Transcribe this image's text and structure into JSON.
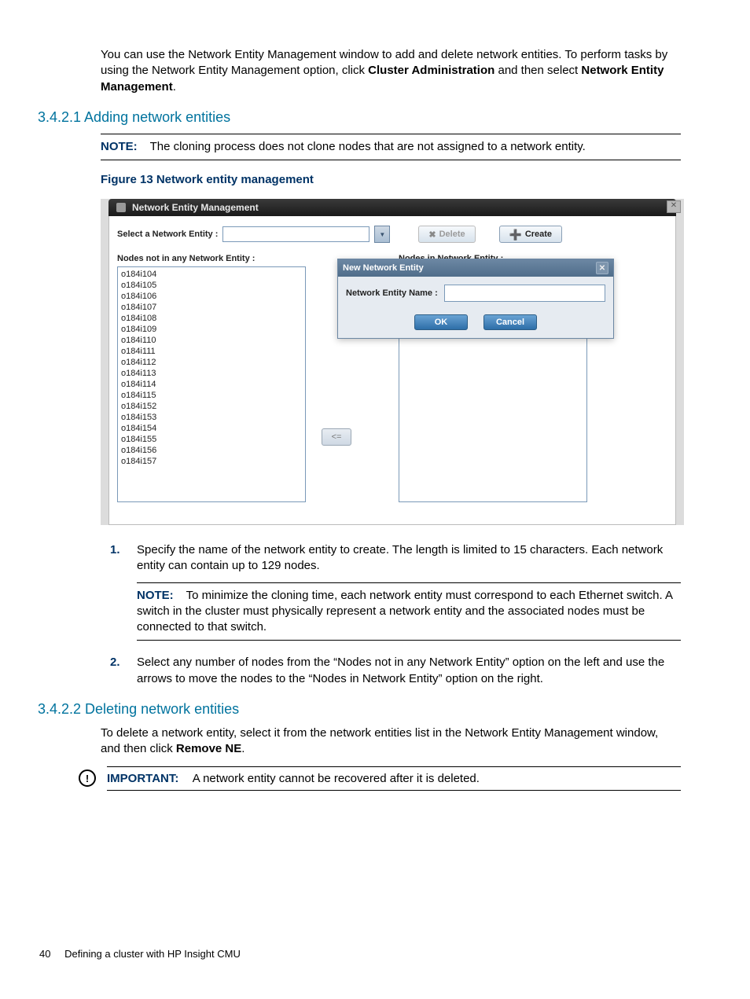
{
  "intro": {
    "p1a": "You can use the Network Entity Management window to add and delete network entities. To perform tasks by using the Network Entity Management option, click ",
    "p1b": "Cluster Administration",
    "p1c": " and then select ",
    "p1d": "Network Entity Management",
    "p1e": "."
  },
  "section1": {
    "heading": "3.4.2.1 Adding network entities",
    "note_label": "NOTE:",
    "note_text": "The cloning process does not clone nodes that are not assigned to a network entity."
  },
  "figure": {
    "caption": "Figure 13 Network entity management"
  },
  "window": {
    "title": "Network Entity Management",
    "select_label": "Select a Network Entity :",
    "delete_btn": "Delete",
    "create_btn": "Create",
    "left_list_label": "Nodes not in any Network Entity :",
    "right_list_label": "Nodes in Network Entity :",
    "arrow_left": "<=",
    "nodes": [
      "o184i104",
      "o184i105",
      "o184i106",
      "o184i107",
      "o184i108",
      "o184i109",
      "o184i110",
      "o184i111",
      "o184i112",
      "o184i113",
      "o184i114",
      "o184i115",
      "o184i152",
      "o184i153",
      "o184i154",
      "o184i155",
      "o184i156",
      "o184i157"
    ],
    "popup": {
      "title": "New Network Entity",
      "field_label": "Network Entity Name :",
      "ok": "OK",
      "cancel": "Cancel"
    }
  },
  "steps": {
    "s1": "Specify the name of the network entity to create. The length is limited to 15 characters. Each network entity can contain up to 129 nodes.",
    "s1_note_label": "NOTE:",
    "s1_note": "To minimize the cloning time, each network entity must correspond to each Ethernet switch. A switch in the cluster must physically represent a network entity and the associated nodes must be connected to that switch.",
    "s2": "Select any number of nodes from the “Nodes not in any Network Entity” option on the left and use the arrows to move the nodes to the “Nodes in Network Entity” option on the right."
  },
  "section2": {
    "heading": "3.4.2.2 Deleting network entities",
    "p1a": "To delete a network entity, select it from the network entities list in the Network Entity Management window, and then click ",
    "p1b": "Remove NE",
    "p1c": ".",
    "imp_label": "IMPORTANT:",
    "imp_text": "A network entity cannot be recovered after it is deleted."
  },
  "footer": {
    "page": "40",
    "title": "Defining a cluster with HP Insight CMU"
  }
}
